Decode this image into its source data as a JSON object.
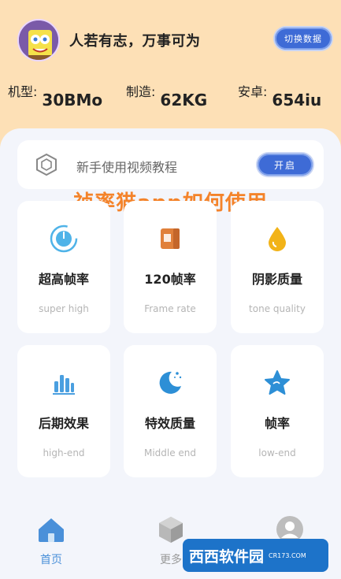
{
  "header": {
    "username": "人若有志，万事可为",
    "switch_label": "切换数据"
  },
  "stats": [
    {
      "label": "机型:",
      "value": "30BMo"
    },
    {
      "label": "制造:",
      "value": "62KG"
    },
    {
      "label": "安卓:",
      "value": "654iu"
    }
  ],
  "tutorial": {
    "text": "新手使用视频教程",
    "button_label": "开启"
  },
  "overlay_title": "祯率猫app如何使用",
  "features": [
    {
      "title": "超高帧率",
      "subtitle": "super high",
      "icon": "dial-icon",
      "color": "#4fb3e8"
    },
    {
      "title": "120帧率",
      "subtitle": "Frame rate",
      "icon": "film-icon",
      "color": "#e0803a"
    },
    {
      "title": "阴影质量",
      "subtitle": "tone quality",
      "icon": "drop-icon",
      "color": "#f2b318"
    },
    {
      "title": "后期效果",
      "subtitle": "high-end",
      "icon": "bars-icon",
      "color": "#4a9fe0"
    },
    {
      "title": "特效质量",
      "subtitle": "Middle end",
      "icon": "moon-icon",
      "color": "#2d8fd6"
    },
    {
      "title": "帧率",
      "subtitle": "low-end",
      "icon": "star-icon",
      "color": "#2d8fd6"
    }
  ],
  "tabbar": [
    {
      "label": "首页",
      "icon": "home-icon",
      "active": true
    },
    {
      "label": "更多",
      "icon": "cube-icon",
      "active": false
    },
    {
      "label": "",
      "icon": "profile-icon",
      "active": false
    }
  ],
  "watermark": {
    "main": "西西软件园",
    "sub": "CR173.COM"
  },
  "colors": {
    "accent": "#3e6bd6",
    "header_bg": "#fde0b6",
    "title_orange": "#f4832a"
  }
}
